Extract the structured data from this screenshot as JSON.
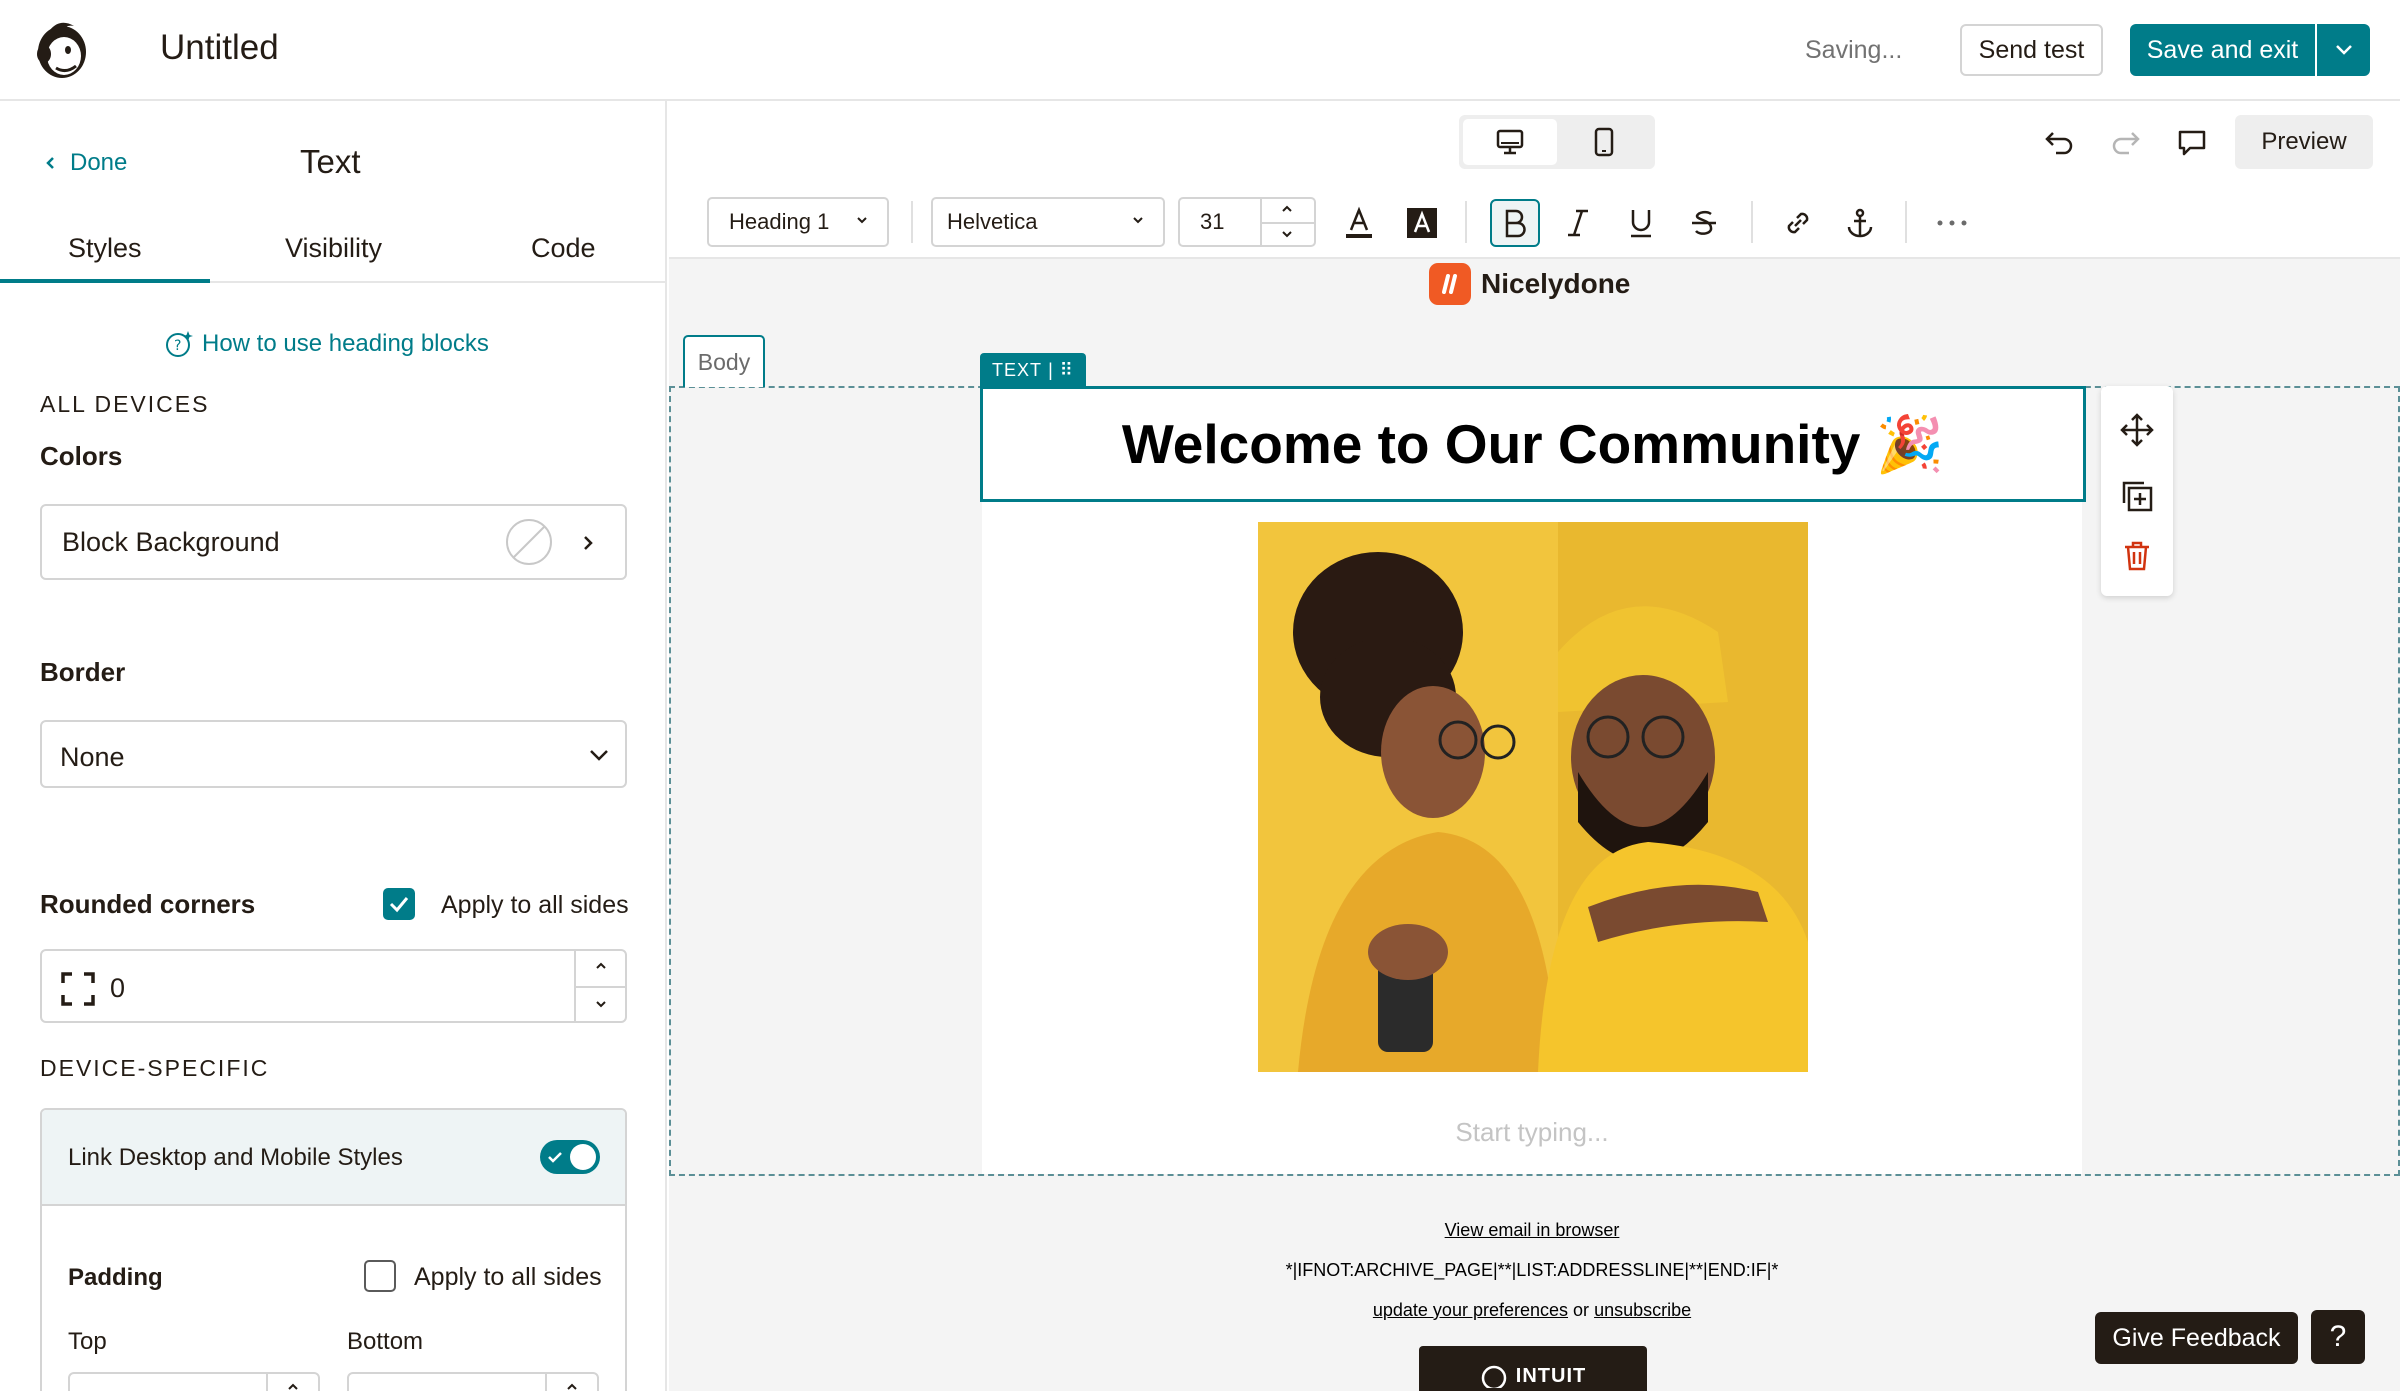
{
  "header": {
    "title": "Untitled",
    "status": "Saving...",
    "send_test_label": "Send test",
    "save_exit_label": "Save and exit"
  },
  "left_panel": {
    "done_label": "Done",
    "title": "Text",
    "tabs": [
      {
        "label": "Styles",
        "active": true
      },
      {
        "label": "Visibility",
        "active": false
      },
      {
        "label": "Code",
        "active": false
      }
    ],
    "help_link": "How to use heading blocks",
    "all_devices_label": "ALL DEVICES",
    "colors_label": "Colors",
    "block_background_label": "Block Background",
    "border_label": "Border",
    "border_value": "None",
    "rounded_corners_label": "Rounded corners",
    "rounded_apply_all_label": "Apply to all sides",
    "rounded_apply_all_checked": true,
    "rounded_value": "0",
    "device_specific_label": "DEVICE-SPECIFIC",
    "link_styles_label": "Link Desktop and Mobile Styles",
    "link_styles_on": true,
    "padding_label": "Padding",
    "padding_apply_all_label": "Apply to all sides",
    "padding_apply_all_checked": false,
    "top_label": "Top",
    "bottom_label": "Bottom"
  },
  "canvas": {
    "preview_label": "Preview",
    "toolbar": {
      "style_select": "Heading 1",
      "font_select": "Helvetica",
      "font_size": "31"
    },
    "brand_name": "Nicelydone",
    "body_tag": "Body",
    "text_tag": "TEXT",
    "heading_text": "Welcome to Our Community 🎉",
    "placeholder_text": "Start typing...",
    "footer": {
      "view_in_browser": "View email in browser",
      "merge_tags": "*|IFNOT:ARCHIVE_PAGE|**|LIST:ADDRESSLINE|**|END:IF|*",
      "update_prefs": "update your preferences",
      "or_text": "or",
      "unsubscribe": "unsubscribe",
      "badge_text": "INTUIT"
    }
  },
  "floating": {
    "feedback_label": "Give Feedback",
    "help_label": "?"
  },
  "colors": {
    "accent": "#007c89",
    "dark": "#241c15",
    "brand_orange": "#f05a24"
  }
}
